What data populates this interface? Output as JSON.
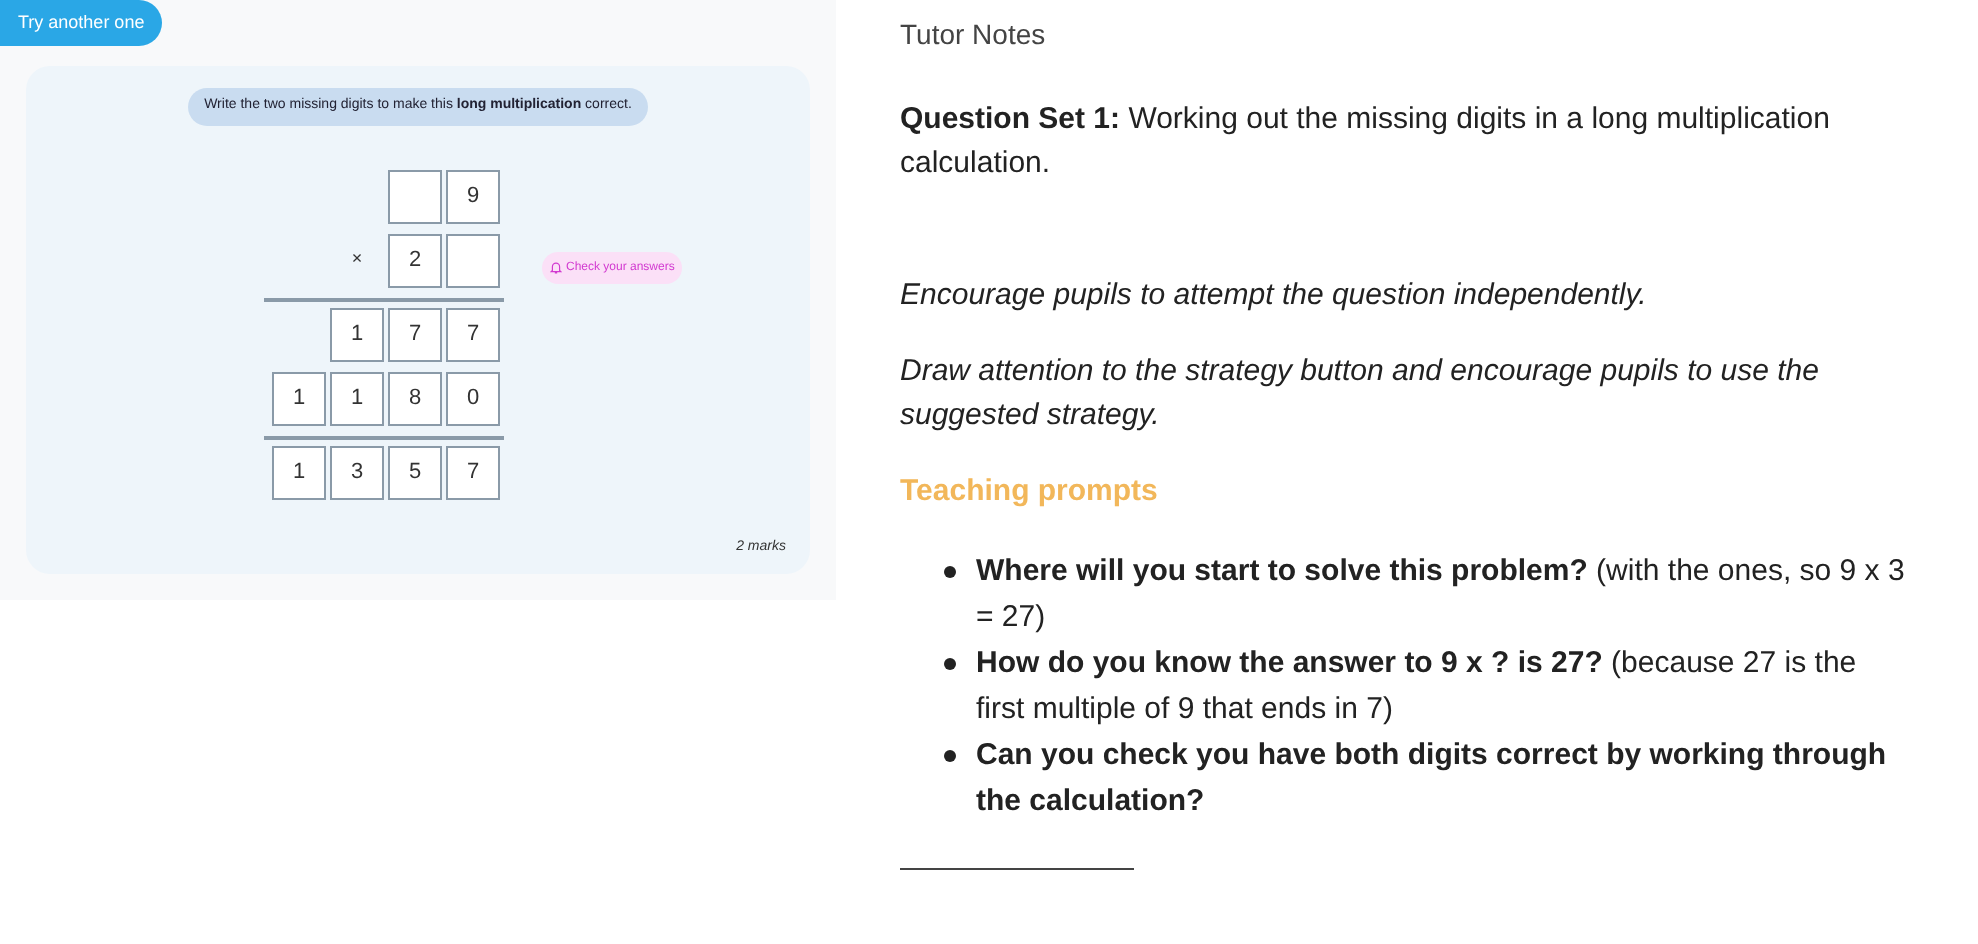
{
  "try_button": "Try another one",
  "question": {
    "prompt": "Write the two missing digits to make this **long multiplication** correct.",
    "grid": [
      {
        "rule_above": false,
        "cells": [
          {
            "kind": "blank"
          },
          {
            "kind": "blank"
          },
          {
            "kind": "input"
          },
          {
            "kind": "digit",
            "value": "9"
          }
        ]
      },
      {
        "rule_above": false,
        "cells": [
          {
            "kind": "blank"
          },
          {
            "kind": "sign",
            "value": "×"
          },
          {
            "kind": "digit",
            "value": "2"
          },
          {
            "kind": "input"
          }
        ]
      },
      {
        "rule_above": true,
        "cells": [
          {
            "kind": "blank"
          },
          {
            "kind": "digit",
            "value": "1"
          },
          {
            "kind": "digit",
            "value": "7"
          },
          {
            "kind": "digit",
            "value": "7"
          }
        ]
      },
      {
        "rule_above": false,
        "cells": [
          {
            "kind": "digit",
            "value": "1"
          },
          {
            "kind": "digit",
            "value": "1"
          },
          {
            "kind": "digit",
            "value": "8"
          },
          {
            "kind": "digit",
            "value": "0"
          }
        ]
      },
      {
        "rule_above": true,
        "cells": [
          {
            "kind": "digit",
            "value": "1"
          },
          {
            "kind": "digit",
            "value": "3"
          },
          {
            "kind": "digit",
            "value": "5"
          },
          {
            "kind": "digit",
            "value": "7"
          }
        ]
      }
    ],
    "check_button": "Check your answers",
    "marks": "2 marks"
  },
  "notes": {
    "title": "Tutor Notes",
    "intro": "**Question Set 1:** Working out the missing digits in a long multiplication calculation.",
    "guidance": [
      "Encourage pupils to attempt the question independently.",
      "Draw attention to the strategy button and encourage pupils to use the suggested strategy."
    ],
    "prompts_heading": "Teaching prompts",
    "prompts": [
      "**Where will you start to solve this problem?** (with the ones, so 9 x 3 = 27)",
      "**How do you know the answer to 9 x ? is 27?** (because 27 is the first multiple of 9 that ends in 7)",
      "**Can you check you have both digits correct by working through the calculation?**"
    ]
  }
}
